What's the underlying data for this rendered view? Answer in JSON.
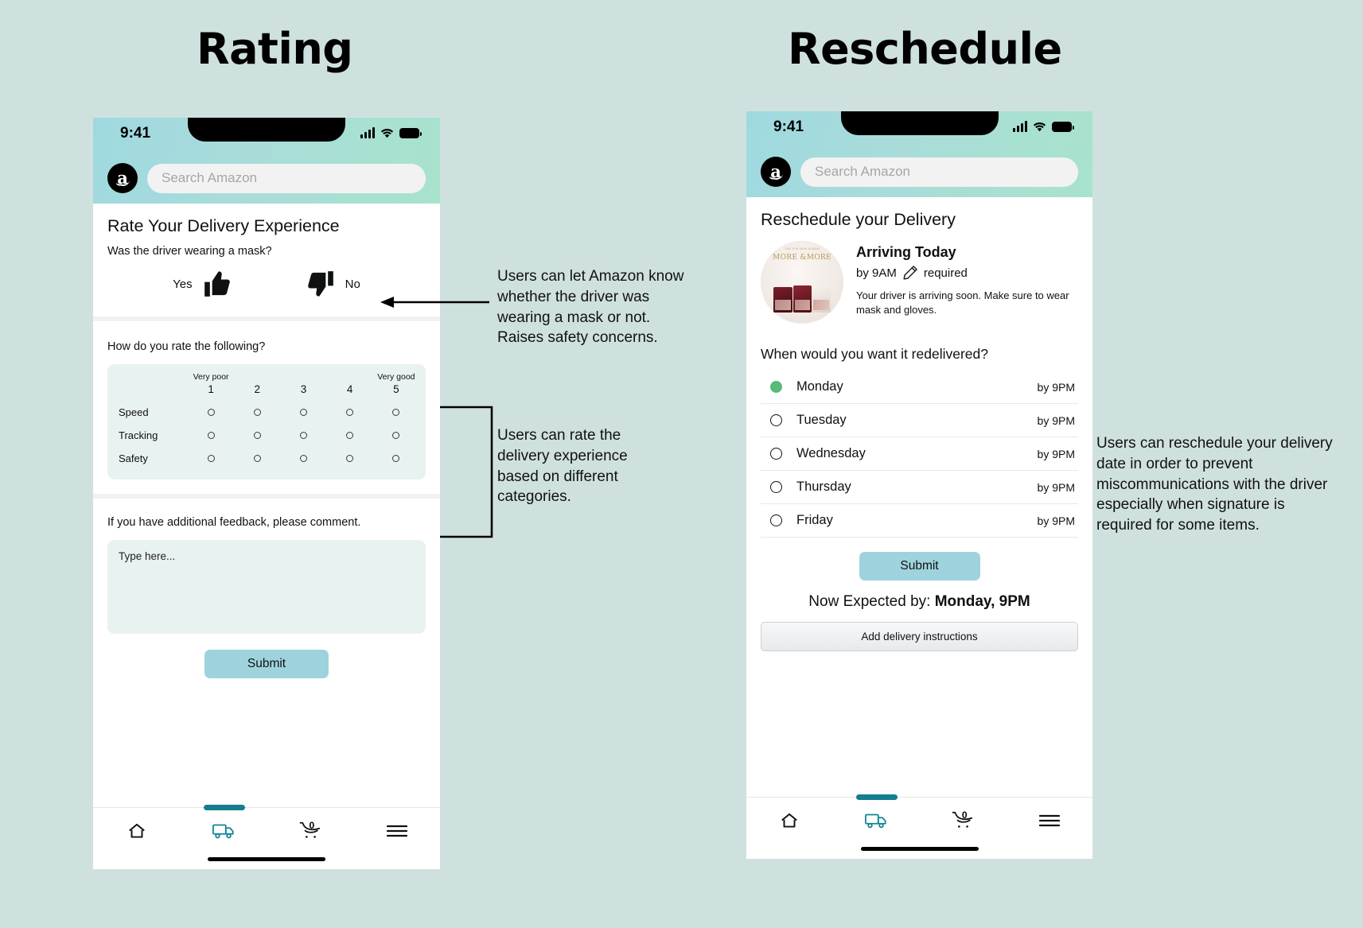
{
  "headings": {
    "left": "Rating",
    "right": "Reschedule"
  },
  "status_bar": {
    "time": "9:41",
    "icons": [
      "signal-icon",
      "wifi-icon",
      "battery-icon"
    ]
  },
  "search": {
    "placeholder": "Search Amazon",
    "logo_letter": "a"
  },
  "rating_screen": {
    "title": "Rate Your Delivery Experience",
    "mask_question": "Was the driver wearing a mask?",
    "yes_label": "Yes",
    "no_label": "No",
    "rate_question": "How do you rate the following?",
    "scale_low_label": "Very poor",
    "scale_high_label": "Very good",
    "scale_numbers": [
      "1",
      "2",
      "3",
      "4",
      "5"
    ],
    "categories": [
      "Speed",
      "Tracking",
      "Safety"
    ],
    "feedback_question": "If you have additional feedback, please comment.",
    "comment_placeholder": "Type here...",
    "submit_label": "Submit"
  },
  "reschedule_screen": {
    "title": "Reschedule your Delivery",
    "order": {
      "album_sub": "THE 9TH MINI ALBUM",
      "album_title": "MORE\n&MORE",
      "arriving": "Arriving Today",
      "by_time": "by 9AM",
      "signature_text": "required",
      "note": "Your driver is arriving soon. Make sure to wear mask and gloves."
    },
    "redeliver_question": "When would you want it redelivered?",
    "days": [
      {
        "name": "Monday",
        "time": "by 9PM",
        "selected": true
      },
      {
        "name": "Tuesday",
        "time": "by 9PM",
        "selected": false
      },
      {
        "name": "Wednesday",
        "time": "by 9PM",
        "selected": false
      },
      {
        "name": "Thursday",
        "time": "by 9PM",
        "selected": false
      },
      {
        "name": "Friday",
        "time": "by 9PM",
        "selected": false
      }
    ],
    "submit_label": "Submit",
    "expected_prefix": "Now Expected by: ",
    "expected_value": "Monday, 9PM",
    "instructions_label": "Add delivery instructions"
  },
  "bottom_nav": {
    "items": [
      "home-icon",
      "delivery-truck-icon",
      "cart-icon",
      "menu-icon"
    ],
    "cart_count": "0"
  },
  "annotations": {
    "mask": "Users can let Amazon know whether the driver was wearing a mask or not. Raises safety concerns.",
    "rating": "Users can rate the delivery experience based on different categories.",
    "reschedule": "Users can reschedule your delivery date in order to prevent miscommunications with the driver especially when signature is required for some items."
  },
  "colors": {
    "background": "#cfe1de",
    "header_gradient_start": "#9fd9e0",
    "header_gradient_end": "#a8e3cd",
    "accent_teal": "#127f8e",
    "submit_button": "#9ed3dd",
    "card_fill": "#e8f2f1",
    "selected_radio_green": "#57bb79"
  }
}
